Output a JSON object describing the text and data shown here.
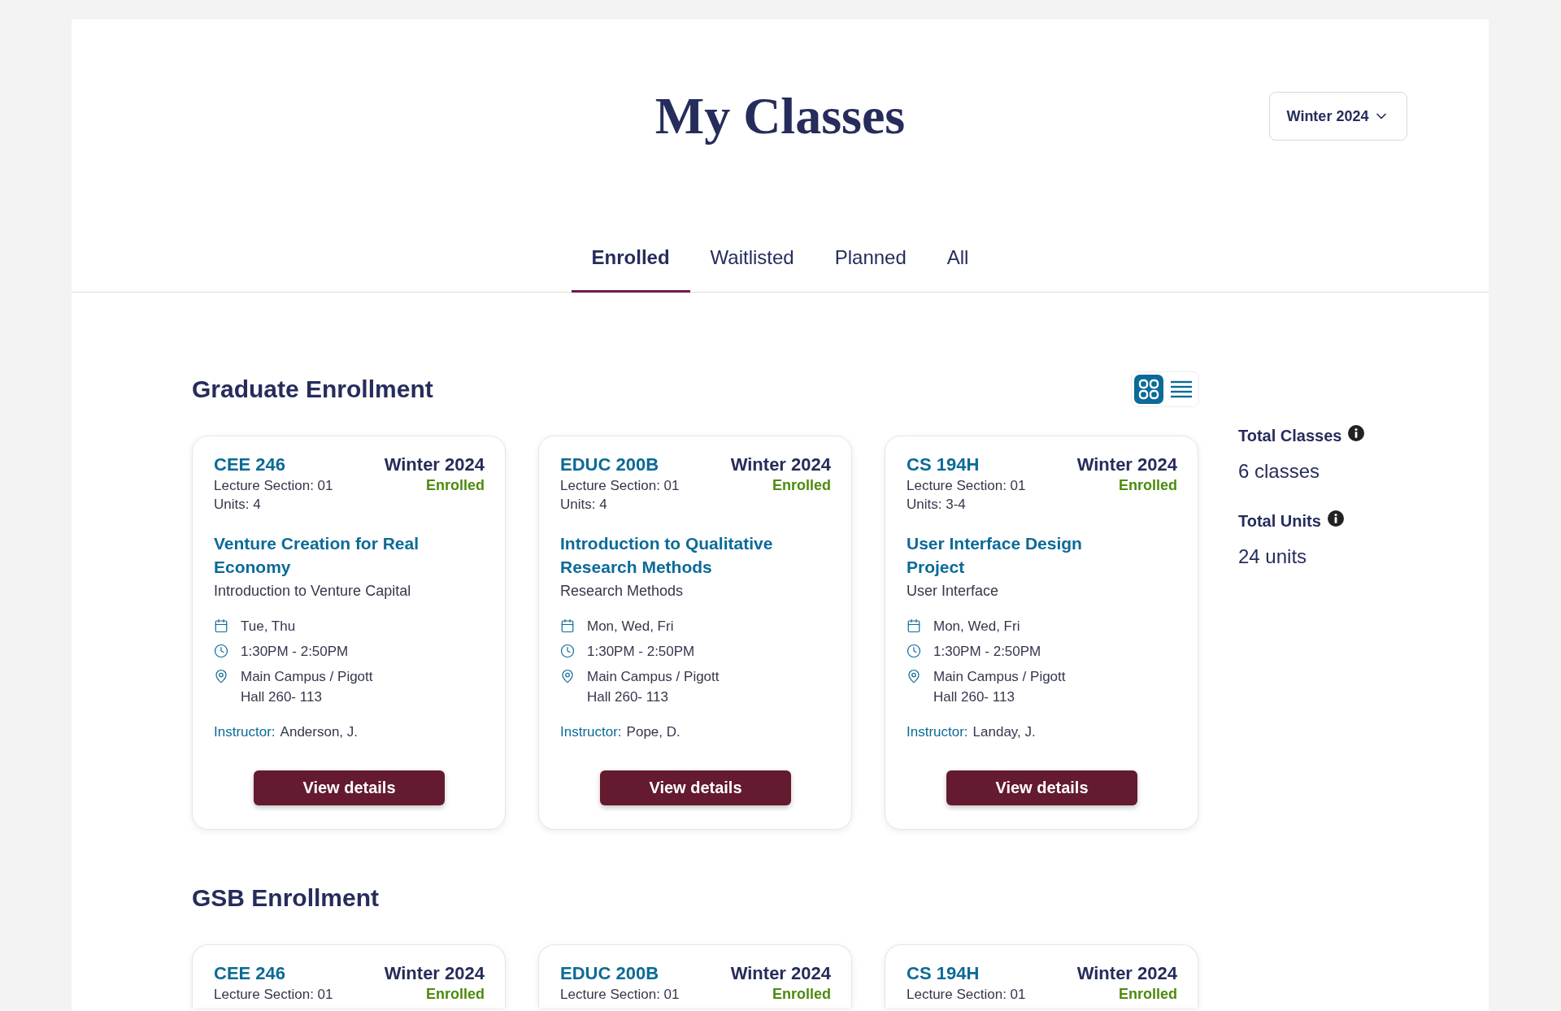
{
  "page_title": "My Classes",
  "term_dropdown": {
    "value": "Winter 2024"
  },
  "tabs": [
    {
      "label": "Enrolled",
      "selected": true
    },
    {
      "label": "Waitlisted",
      "selected": false
    },
    {
      "label": "Planned",
      "selected": false
    },
    {
      "label": "All",
      "selected": false
    }
  ],
  "sections": [
    {
      "title": "Graduate Enrollment",
      "view_toggle": [
        {
          "kind": "grid",
          "selected": true
        },
        {
          "kind": "list",
          "selected": false
        }
      ],
      "courses": [
        {
          "code": "CEE 246",
          "term": "Winter 2024",
          "status": "Enrolled",
          "section": "Lecture Section: 01",
          "units": "Units: 4",
          "title": "Venture Creation for Real Economy",
          "subtitle": "Introduction to Venture Capital",
          "schedule": [
            {
              "kind": "days",
              "text": "Tue, Thu"
            },
            {
              "kind": "time",
              "text": "1:30PM - 2:50PM"
            },
            {
              "kind": "location",
              "text": "Main Campus / Pigott Hall 260- 113"
            }
          ],
          "instructor": {
            "label": "Instructor:",
            "name": "Anderson, J."
          },
          "button": "View details"
        },
        {
          "code": "EDUC 200B",
          "term": "Winter 2024",
          "status": "Enrolled",
          "section": "Lecture Section: 01",
          "units": "Units: 4",
          "title": "Introduction to Qualitative Research Methods",
          "subtitle": "Research Methods",
          "schedule": [
            {
              "kind": "days",
              "text": "Mon, Wed, Fri"
            },
            {
              "kind": "time",
              "text": "1:30PM - 2:50PM"
            },
            {
              "kind": "location",
              "text": "Main Campus / Pigott Hall 260- 113"
            }
          ],
          "instructor": {
            "label": "Instructor:",
            "name": "Pope, D."
          },
          "button": "View details"
        },
        {
          "code": "CS 194H",
          "term": "Winter 2024",
          "status": "Enrolled",
          "section": "Lecture Section: 01",
          "units": "Units: 3-4",
          "title": "User Interface Design Project",
          "subtitle": "User Interface",
          "schedule": [
            {
              "kind": "days",
              "text": "Mon, Wed, Fri"
            },
            {
              "kind": "time",
              "text": "1:30PM - 2:50PM"
            },
            {
              "kind": "location",
              "text": "Main Campus / Pigott Hall 260- 113"
            }
          ],
          "instructor": {
            "label": "Instructor:",
            "name": "Landay, J."
          },
          "button": "View details"
        }
      ]
    },
    {
      "title": "GSB Enrollment",
      "courses": [
        {
          "code": "CEE 246",
          "term": "Winter 2024",
          "status": "Enrolled",
          "section": "Lecture Section: 01"
        },
        {
          "code": "EDUC 200B",
          "term": "Winter 2024",
          "status": "Enrolled",
          "section": "Lecture Section: 01"
        },
        {
          "code": "CS 194H",
          "term": "Winter 2024",
          "status": "Enrolled",
          "section": "Lecture Section: 01"
        }
      ]
    }
  ],
  "summary": [
    {
      "label": "Total Classes",
      "value": "6 classes"
    },
    {
      "label": "Total Units",
      "value": "24 units"
    }
  ]
}
